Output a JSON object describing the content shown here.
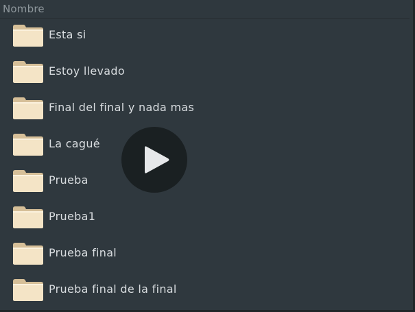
{
  "header": {
    "column_name": "Nombre"
  },
  "files": [
    {
      "name": "Esta si",
      "icon": "folder-icon"
    },
    {
      "name": "Estoy llevado",
      "icon": "folder-icon"
    },
    {
      "name": "Final del final y nada mas",
      "icon": "folder-icon"
    },
    {
      "name": "La cagué",
      "icon": "folder-icon"
    },
    {
      "name": "Prueba",
      "icon": "folder-icon"
    },
    {
      "name": "Prueba1",
      "icon": "folder-icon"
    },
    {
      "name": "Prueba final",
      "icon": "folder-icon"
    },
    {
      "name": "Prueba final de la final",
      "icon": "folder-icon"
    }
  ],
  "overlay": {
    "icon": "play-icon"
  },
  "colors": {
    "background": "#2f383e",
    "text": "#d9dde0",
    "header_text": "#8e979c",
    "folder_body": "#f3e2c3",
    "folder_shade": "#d8c29c"
  }
}
